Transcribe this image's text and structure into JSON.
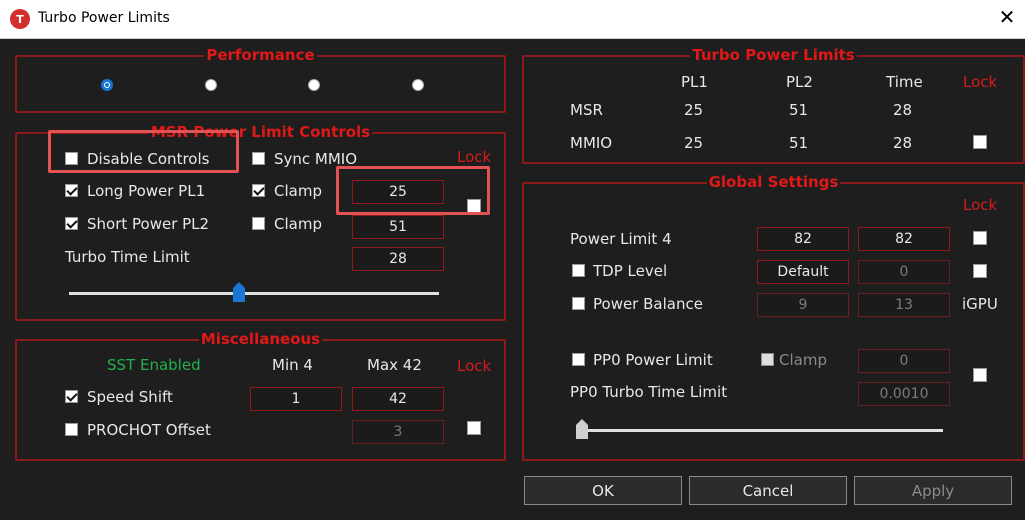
{
  "window": {
    "title": "Turbo Power Limits",
    "icon_letter": "T"
  },
  "performance": {
    "legend": "Performance",
    "selected_index": 0
  },
  "msr_controls": {
    "legend": "MSR Power Limit Controls",
    "lock": "Lock",
    "disable_controls": "Disable Controls",
    "sync_mmio": "Sync MMIO",
    "long_power_pl1": "Long Power PL1",
    "short_power_pl2": "Short Power PL2",
    "clamp1": "Clamp",
    "clamp2": "Clamp",
    "pl1_value": "25",
    "pl2_value": "51",
    "turbo_time_limit": "Turbo Time Limit",
    "ttl_value": "28",
    "slider_fraction": 0.46
  },
  "misc": {
    "legend": "Miscellaneous",
    "sst_enabled": "SST Enabled",
    "min_label": "Min  4",
    "max_label": "Max  42",
    "lock": "Lock",
    "speed_shift": "Speed Shift",
    "speed_min": "1",
    "speed_max": "42",
    "prochot_offset": "PROCHOT Offset",
    "prochot_value": "3"
  },
  "tpl": {
    "legend": "Turbo Power Limits",
    "col_pl1": "PL1",
    "col_pl2": "PL2",
    "col_time": "Time",
    "lock": "Lock",
    "msr_label": "MSR",
    "msr_pl1": "25",
    "msr_pl2": "51",
    "msr_time": "28",
    "mmio_label": "MMIO",
    "mmio_pl1": "25",
    "mmio_pl2": "51",
    "mmio_time": "28"
  },
  "global": {
    "legend": "Global Settings",
    "lock": "Lock",
    "power_limit_4": "Power Limit 4",
    "pl4_a": "82",
    "pl4_b": "82",
    "tdp_level": "TDP Level",
    "tdp_value": "Default",
    "tdp_b": "0",
    "power_balance": "Power Balance",
    "pb_a": "9",
    "pb_b": "13",
    "igpu": "iGPU",
    "pp0_power_limit": "PP0 Power Limit",
    "pp0_clamp": "Clamp",
    "pp0_value": "0",
    "pp0_turbo_time_limit": "PP0 Turbo Time Limit",
    "pp0_ttl_value": "0.0010",
    "slider_fraction": 0.0
  },
  "buttons": {
    "ok": "OK",
    "cancel": "Cancel",
    "apply": "Apply"
  },
  "colors": {
    "accent_red": "#e01818",
    "border_red": "#8b1a1a",
    "highlight": "#e35353",
    "radio_blue": "#1976d2",
    "thumb_blue": "#1976d2"
  }
}
